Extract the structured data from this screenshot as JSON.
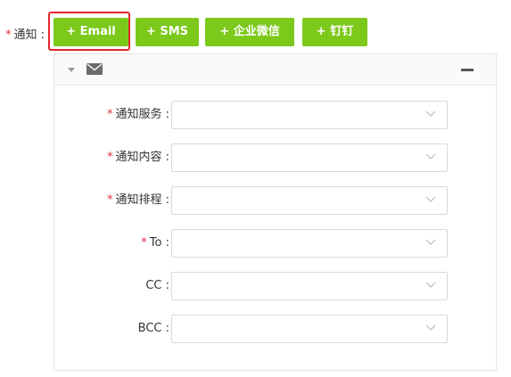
{
  "notify": {
    "required_mark": "*",
    "label": "通知 :"
  },
  "channel_buttons": [
    {
      "label": "+ Email"
    },
    {
      "label": "+ SMS"
    },
    {
      "label": "+ 企业微信"
    },
    {
      "label": "+ 钉钉"
    }
  ],
  "panel": {
    "header_icon": "mail-icon",
    "fields": [
      {
        "label": "通知服务 :",
        "required": true,
        "value": ""
      },
      {
        "label": "通知内容 :",
        "required": true,
        "value": ""
      },
      {
        "label": "通知排程 :",
        "required": true,
        "value": ""
      },
      {
        "label": "To :",
        "required": true,
        "value": ""
      },
      {
        "label": "CC :",
        "required": false,
        "value": ""
      },
      {
        "label": "BCC :",
        "required": false,
        "value": ""
      }
    ]
  },
  "colors": {
    "accent": "#7cc91c",
    "highlight": "#e4252c",
    "required": "#e0303a"
  }
}
